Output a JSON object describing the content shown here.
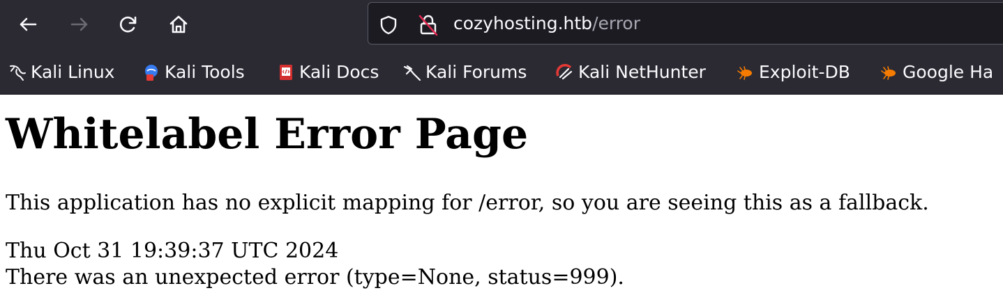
{
  "browser": {
    "nav": {
      "back_icon": "arrow-left-icon",
      "forward_icon": "arrow-right-icon",
      "reload_icon": "reload-icon",
      "home_icon": "home-icon"
    },
    "url_bar": {
      "shield_icon": "shield-icon",
      "lock_icon": "insecure-lock-icon",
      "host": "cozyhosting.htb",
      "path": "/error"
    },
    "bookmarks": [
      {
        "label": "Kali Linux",
        "icon": "kali-dragon-icon"
      },
      {
        "label": "Kali Tools",
        "icon": "kali-tools-icon"
      },
      {
        "label": "Kali Docs",
        "icon": "kali-docs-icon"
      },
      {
        "label": "Kali Forums",
        "icon": "kali-forums-icon"
      },
      {
        "label": "Kali NetHunter",
        "icon": "nethunter-icon"
      },
      {
        "label": "Exploit-DB",
        "icon": "exploit-db-icon"
      },
      {
        "label": "Google Ha",
        "icon": "google-hacking-db-icon"
      }
    ],
    "colors": {
      "toolbar_bg": "#2b2a33",
      "url_bar_bg": "#1c1b22",
      "text": "#fbfbfe",
      "path_text": "#a8a8b3"
    }
  },
  "page": {
    "title": "Whitelabel Error Page",
    "message": "This application has no explicit mapping for /error, so you are seeing this as a fallback.",
    "timestamp": "Thu Oct 31 19:39:37 UTC 2024",
    "error_detail": "There was an unexpected error (type=None, status=999)."
  }
}
